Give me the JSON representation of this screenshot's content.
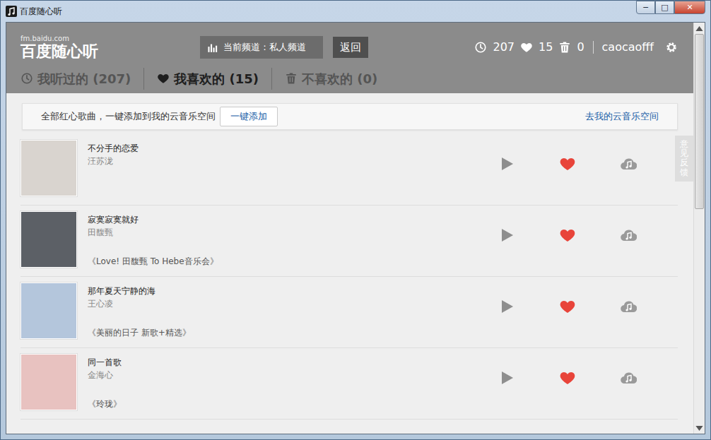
{
  "window": {
    "title": "百度随心听",
    "controls": [
      "─",
      "□",
      "✕"
    ]
  },
  "header": {
    "logo_url": "fm.baidu.com",
    "logo_name": "百度随心听",
    "channel": "当前频道：私人频道",
    "back": "返回",
    "stats": [
      {
        "kind": "history",
        "value": "207"
      },
      {
        "kind": "liked",
        "value": "15"
      },
      {
        "kind": "trash",
        "value": "0"
      }
    ],
    "user": "caocaofff"
  },
  "tabs": [
    {
      "label": "我听过的 (207)",
      "kind": "history",
      "selected": false
    },
    {
      "label": "我喜欢的 (15)",
      "kind": "liked",
      "selected": true
    },
    {
      "label": "不喜欢的 (0)",
      "kind": "trash",
      "selected": false
    }
  ],
  "add_bar": {
    "text": "全部红心歌曲，一键添加到我的云音乐空间",
    "button": "一键添加",
    "link": "去我的云音乐空间"
  },
  "songs": [
    {
      "title": "不分手的恋爱",
      "artist": "汪苏泷",
      "liked": true
    },
    {
      "title": "寂寞寂寞就好",
      "artist": "田馥甄",
      "album": "《Love! 田馥甄 To Hebe音乐会》",
      "liked": true
    },
    {
      "title": "那年夏天宁静的海",
      "artist": "王心凌",
      "album": "《美丽的日子 新歌+精选》",
      "liked": true
    },
    {
      "title": "同一首歌",
      "artist": "金海心",
      "album": "《玲珑》",
      "liked": true
    }
  ],
  "feedback": "意见反馈",
  "scrollbar": {
    "position": 0.0,
    "thumb_size": 0.45
  }
}
